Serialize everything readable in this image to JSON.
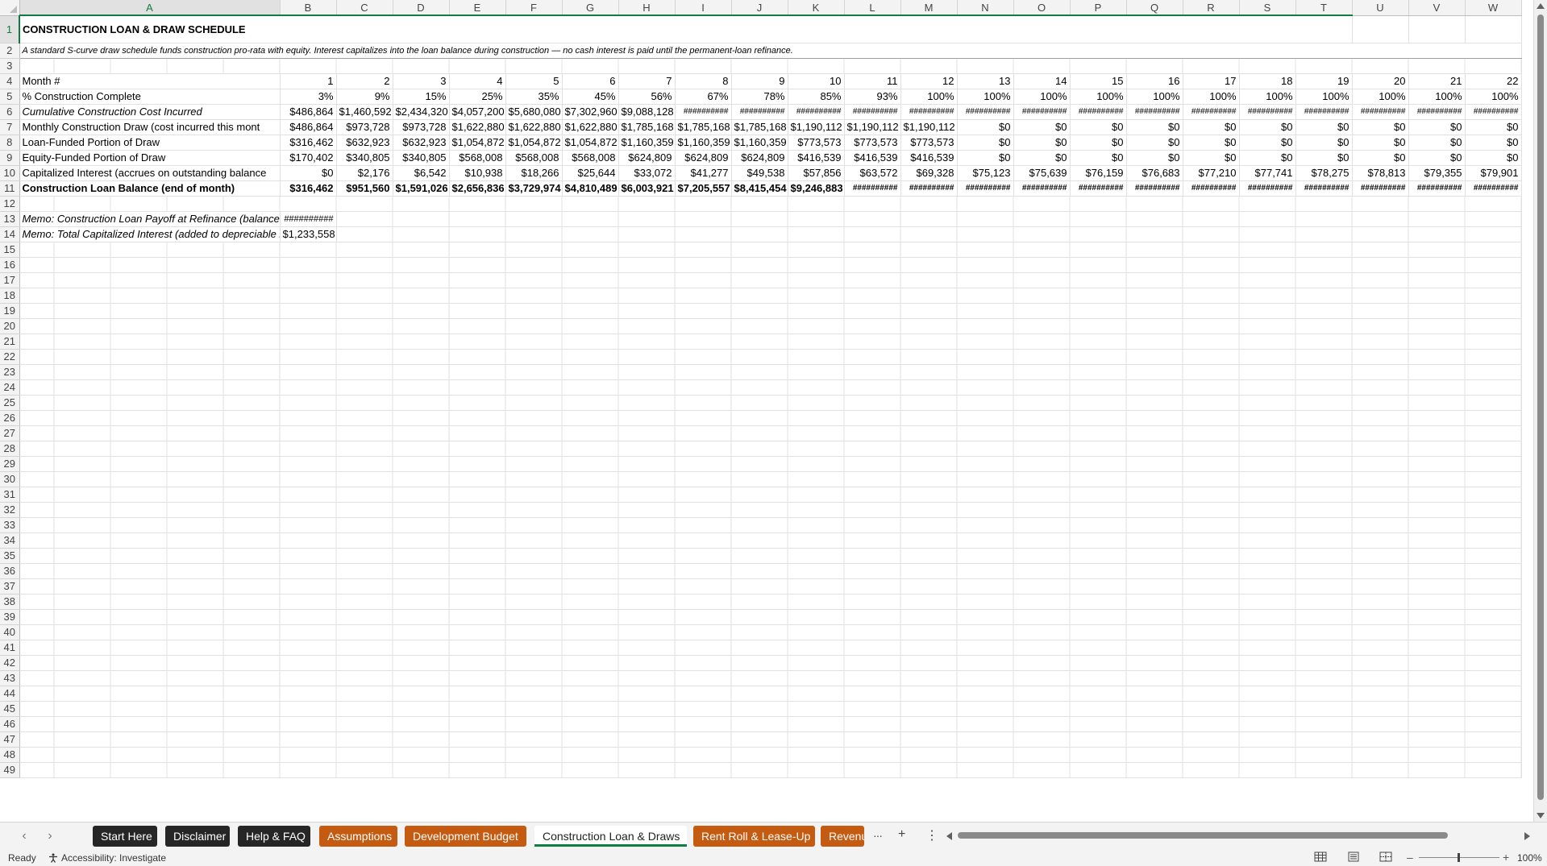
{
  "sheet": {
    "columns": [
      "A",
      "B",
      "C",
      "D",
      "E",
      "F",
      "G",
      "H",
      "I",
      "J",
      "K",
      "L",
      "M",
      "N",
      "O",
      "P",
      "Q",
      "R",
      "S",
      "T",
      "U",
      "V",
      "W"
    ],
    "title": "CONSTRUCTION LOAN & DRAW SCHEDULE",
    "subtitle": "A standard S-curve draw schedule funds construction pro-rata with equity. Interest capitalizes into the loan balance during construction — no cash interest is paid until the permanent-loan refinance.",
    "rows": {
      "month": {
        "label": "Month #",
        "values": [
          "1",
          "2",
          "3",
          "4",
          "5",
          "6",
          "7",
          "8",
          "9",
          "10",
          "11",
          "12",
          "13",
          "14",
          "15",
          "16",
          "17",
          "18",
          "19",
          "20",
          "21",
          "22"
        ]
      },
      "pct_complete": {
        "label": "% Construction Complete",
        "values": [
          "3%",
          "9%",
          "15%",
          "25%",
          "35%",
          "45%",
          "56%",
          "67%",
          "78%",
          "85%",
          "93%",
          "100%",
          "100%",
          "100%",
          "100%",
          "100%",
          "100%",
          "100%",
          "100%",
          "100%",
          "100%",
          "100%"
        ]
      },
      "cumulative_cost": {
        "label": "Cumulative Construction Cost Incurred",
        "values": [
          "$486,864",
          "$1,460,592",
          "$2,434,320",
          "$4,057,200",
          "$5,680,080",
          "$7,302,960",
          "$9,088,128",
          "##########",
          "##########",
          "##########",
          "##########",
          "##########",
          "##########",
          "##########",
          "##########",
          "##########",
          "##########",
          "##########",
          "##########",
          "##########",
          "##########",
          "##########"
        ]
      },
      "monthly_draw": {
        "label": "Monthly Construction Draw (cost incurred this mont",
        "values": [
          "$486,864",
          "$973,728",
          "$973,728",
          "$1,622,880",
          "$1,622,880",
          "$1,622,880",
          "$1,785,168",
          "$1,785,168",
          "$1,785,168",
          "$1,190,112",
          "$1,190,112",
          "$1,190,112",
          "$0",
          "$0",
          "$0",
          "$0",
          "$0",
          "$0",
          "$0",
          "$0",
          "$0",
          "$0"
        ]
      },
      "loan_funded": {
        "label": "Loan-Funded Portion of Draw",
        "values": [
          "$316,462",
          "$632,923",
          "$632,923",
          "$1,054,872",
          "$1,054,872",
          "$1,054,872",
          "$1,160,359",
          "$1,160,359",
          "$1,160,359",
          "$773,573",
          "$773,573",
          "$773,573",
          "$0",
          "$0",
          "$0",
          "$0",
          "$0",
          "$0",
          "$0",
          "$0",
          "$0",
          "$0"
        ]
      },
      "equity_funded": {
        "label": "Equity-Funded Portion of Draw",
        "values": [
          "$170,402",
          "$340,805",
          "$340,805",
          "$568,008",
          "$568,008",
          "$568,008",
          "$624,809",
          "$624,809",
          "$624,809",
          "$416,539",
          "$416,539",
          "$416,539",
          "$0",
          "$0",
          "$0",
          "$0",
          "$0",
          "$0",
          "$0",
          "$0",
          "$0",
          "$0"
        ]
      },
      "cap_interest": {
        "label": "Capitalized Interest (accrues on outstanding balance",
        "values": [
          "$0",
          "$2,176",
          "$6,542",
          "$10,938",
          "$18,266",
          "$25,644",
          "$33,072",
          "$41,277",
          "$49,538",
          "$57,856",
          "$63,572",
          "$69,328",
          "$75,123",
          "$75,639",
          "$76,159",
          "$76,683",
          "$77,210",
          "$77,741",
          "$78,275",
          "$78,813",
          "$79,355",
          "$79,901"
        ]
      },
      "loan_balance": {
        "label": "Construction Loan Balance (end of month)",
        "values": [
          "$316,462",
          "$951,560",
          "$1,591,026",
          "$2,656,836",
          "$3,729,974",
          "$4,810,489",
          "$6,003,921",
          "$7,205,557",
          "$8,415,454",
          "$9,246,883",
          "##########",
          "##########",
          "##########",
          "##########",
          "##########",
          "##########",
          "##########",
          "##########",
          "##########",
          "##########",
          "##########",
          "##########"
        ]
      }
    },
    "overflow_char": "#",
    "memo_payoff": {
      "label": "Memo: Construction Loan Payoff at Refinance (balance the mont",
      "value": "##########"
    },
    "memo_interest": {
      "label": "Memo: Total Capitalized Interest (added to depreciable basis)",
      "value": "$1,233,558"
    }
  },
  "tabs": [
    {
      "label": "Start Here",
      "style": "dark"
    },
    {
      "label": "Disclaimer",
      "style": "dark"
    },
    {
      "label": "Help & FAQ",
      "style": "dark"
    },
    {
      "label": "Assumptions",
      "style": "orange"
    },
    {
      "label": "Development Budget",
      "style": "orange"
    },
    {
      "label": "Construction Loan & Draws",
      "style": "active"
    },
    {
      "label": "Rent Roll & Lease-Up",
      "style": "orange"
    },
    {
      "label": "Revenu",
      "style": "orange"
    }
  ],
  "tab_controls": {
    "more": "···",
    "add": "+",
    "options": "⋮"
  },
  "status": {
    "ready": "Ready",
    "accessibility": "Accessibility: Investigate",
    "zoom": "100%"
  },
  "colors": {
    "accent": "#107c41",
    "orange_tab": "#c55a11",
    "dark_tab": "#262626"
  }
}
